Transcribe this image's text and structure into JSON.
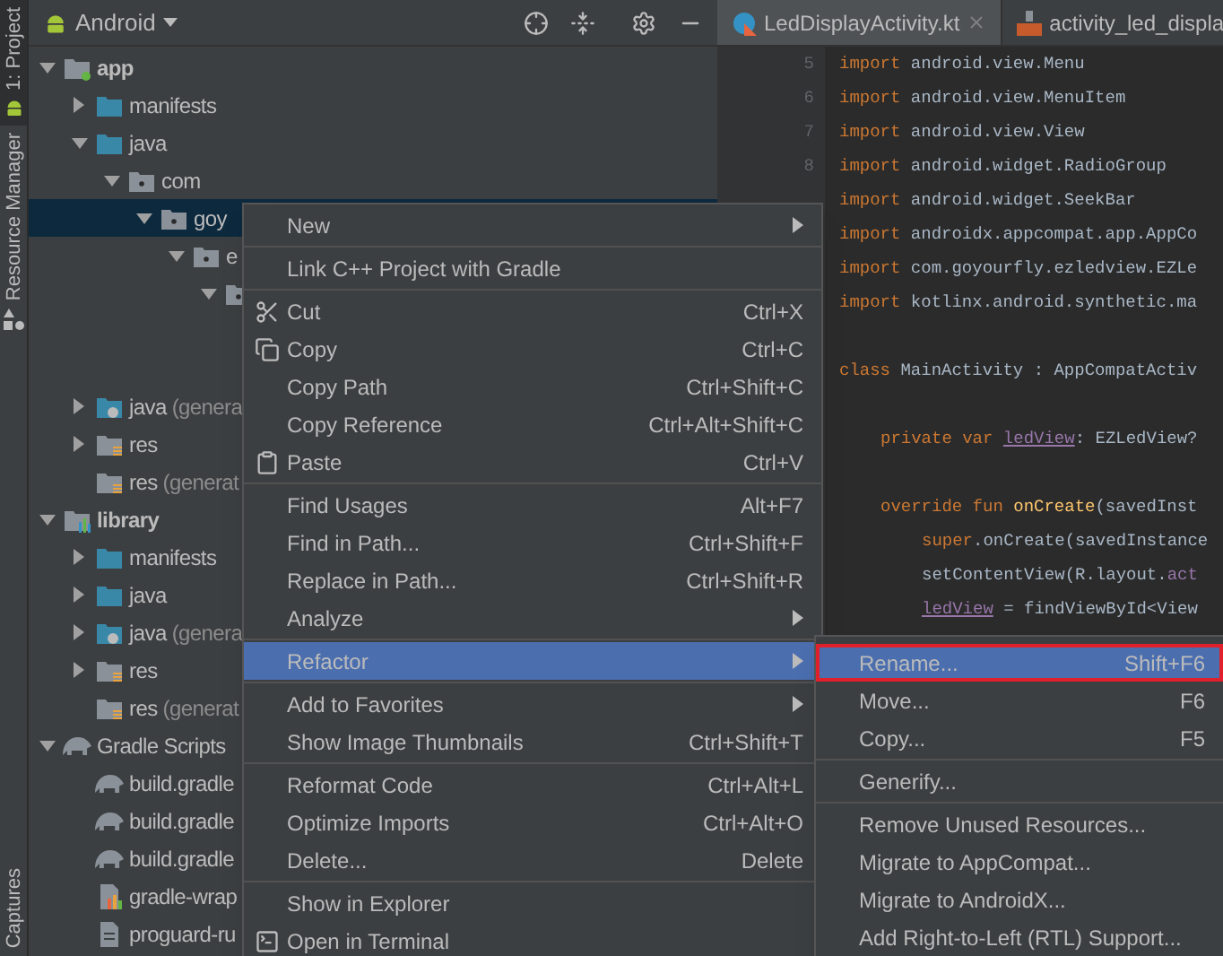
{
  "side_tabs": [
    {
      "label": "1: Project",
      "selected": true
    },
    {
      "label": "Resource Manager",
      "selected": false
    },
    {
      "label": "Captures",
      "selected": false
    }
  ],
  "project_panel": {
    "view": "Android",
    "tree": [
      {
        "label": "app",
        "kind": "module-app",
        "bold": true,
        "expanded": true,
        "selected": false,
        "children": [
          {
            "label": "manifests",
            "kind": "folder",
            "expanded": false,
            "selected": false
          },
          {
            "label": "java",
            "kind": "folder",
            "expanded": true,
            "selected": false,
            "children": [
              {
                "label": "com",
                "kind": "package",
                "expanded": true,
                "selected": false,
                "children": [
                  {
                    "label": "goy",
                    "kind": "package",
                    "expanded": true,
                    "selected": true,
                    "children": [
                      {
                        "label": "e",
                        "kind": "package",
                        "expanded": true,
                        "selected": false,
                        "children": [
                          {
                            "kind": "package",
                            "expanded": true,
                            "selected": false
                          }
                        ]
                      }
                    ]
                  }
                ]
              }
            ]
          },
          {
            "label": "java",
            "note": "(genera",
            "kind": "generated",
            "expanded": false,
            "selected": false
          },
          {
            "label": "res",
            "kind": "res",
            "expanded": false,
            "selected": false
          },
          {
            "label": "res",
            "note": "(generat",
            "kind": "res",
            "selected": false
          }
        ]
      },
      {
        "label": "library",
        "kind": "module-lib",
        "bold": true,
        "expanded": true,
        "selected": false,
        "children": [
          {
            "label": "manifests",
            "kind": "folder",
            "expanded": false,
            "selected": false
          },
          {
            "label": "java",
            "kind": "folder",
            "expanded": false,
            "selected": false
          },
          {
            "label": "java",
            "note": "(genera",
            "kind": "generated",
            "expanded": false,
            "selected": false
          },
          {
            "label": "res",
            "kind": "res",
            "expanded": false,
            "selected": false
          },
          {
            "label": "res",
            "note": "(generat",
            "kind": "res",
            "selected": false
          }
        ]
      },
      {
        "label": "Gradle Scripts",
        "kind": "gradle",
        "expanded": true,
        "selected": false,
        "children": [
          {
            "label": "build.gradle",
            "kind": "gradle",
            "selected": false
          },
          {
            "label": "build.gradle",
            "kind": "gradle",
            "selected": false
          },
          {
            "label": "build.gradle",
            "kind": "gradle",
            "selected": false
          },
          {
            "label": "gradle-wrap",
            "kind": "properties",
            "selected": false
          },
          {
            "label": "proguard-ru",
            "kind": "file",
            "selected": false
          }
        ]
      }
    ]
  },
  "editor": {
    "tabs": [
      {
        "label": "LedDisplayActivity.kt",
        "kind": "kotlin",
        "selected": true,
        "closable": true
      },
      {
        "label": "activity_led_displa",
        "kind": "layout",
        "selected": false,
        "closable": false
      }
    ],
    "lines": [
      {
        "number": "5",
        "kind": "top",
        "tokens": [
          {
            "t": "import ",
            "kind": "kw"
          },
          {
            "t": "android.view.Menu",
            "kind": "plain"
          }
        ]
      },
      {
        "number": "6",
        "kind": "top",
        "tokens": [
          {
            "t": "import ",
            "kind": "kw"
          },
          {
            "t": "android.view.MenuItem",
            "kind": "plain"
          }
        ]
      },
      {
        "number": "7",
        "kind": "top",
        "tokens": [
          {
            "t": "import ",
            "kind": "kw"
          },
          {
            "t": "android.view.View",
            "kind": "plain"
          }
        ]
      },
      {
        "number": "8",
        "kind": "top",
        "tokens": [
          {
            "t": "import ",
            "kind": "kw"
          },
          {
            "t": "android.widget.RadioGroup",
            "kind": "plain"
          }
        ]
      },
      {
        "kind": "top",
        "tokens": [
          {
            "t": "import ",
            "kind": "kw"
          },
          {
            "t": "android.widget.SeekBar",
            "kind": "plain"
          }
        ]
      },
      {
        "kind": "top",
        "tokens": [
          {
            "t": "import ",
            "kind": "kw"
          },
          {
            "t": "androidx.appcompat.app.AppCo",
            "kind": "plain"
          }
        ]
      },
      {
        "kind": "top",
        "tokens": [
          {
            "t": "import ",
            "kind": "kw"
          },
          {
            "t": "com.goyourfly.ezledview.EZLe",
            "kind": "plain"
          }
        ]
      },
      {
        "kind": "top",
        "tokens": [
          {
            "t": "import ",
            "kind": "kw"
          },
          {
            "t": "kotlinx.android.synthetic.ma",
            "kind": "plain"
          }
        ]
      },
      {
        "kind": "blank"
      },
      {
        "kind": "top",
        "tokens": [
          {
            "t": "class ",
            "kind": "kw"
          },
          {
            "t": "MainActivity : AppCompatActiv",
            "kind": "plain"
          }
        ]
      },
      {
        "kind": "blank"
      },
      {
        "kind": "member",
        "tokens": [
          {
            "t": "private var ",
            "kind": "kw"
          },
          {
            "t": "ledView",
            "kind": "field"
          },
          {
            "t": ": EZLedView?",
            "kind": "plain"
          }
        ]
      },
      {
        "kind": "blank"
      },
      {
        "kind": "member",
        "tokens": [
          {
            "t": "override fun ",
            "kind": "kw"
          },
          {
            "t": "onCreate",
            "kind": "fn"
          },
          {
            "t": "(savedInst",
            "kind": "plain"
          }
        ]
      },
      {
        "kind": "body",
        "tokens": [
          {
            "t": "super",
            "kind": "kw"
          },
          {
            "t": ".onCreate(savedInstance",
            "kind": "plain"
          }
        ]
      },
      {
        "kind": "body",
        "tokens": [
          {
            "t": "setContentView(R.layout.",
            "kind": "plain"
          },
          {
            "t": "act",
            "kind": "prop"
          }
        ]
      },
      {
        "kind": "body",
        "tokens": [
          {
            "t": "ledView",
            "kind": "field"
          },
          {
            "t": " = findViewById<View",
            "kind": "plain"
          }
        ]
      }
    ]
  },
  "context_menu": {
    "groups": [
      [
        {
          "label": "New",
          "submenu": true,
          "selected": false
        }
      ],
      [
        {
          "label": "Link C++ Project with Gradle",
          "selected": false
        }
      ],
      [
        {
          "label": "Cut",
          "kind": "scissors",
          "shortcut": "Ctrl+X",
          "selected": false
        },
        {
          "label": "Copy",
          "kind": "copy",
          "shortcut": "Ctrl+C",
          "selected": false
        },
        {
          "label": "Copy Path",
          "shortcut": "Ctrl+Shift+C",
          "selected": false
        },
        {
          "label": "Copy Reference",
          "shortcut": "Ctrl+Alt+Shift+C",
          "selected": false
        },
        {
          "label": "Paste",
          "kind": "clipboard",
          "shortcut": "Ctrl+V",
          "selected": false
        }
      ],
      [
        {
          "label": "Find Usages",
          "shortcut": "Alt+F7",
          "selected": false
        },
        {
          "label": "Find in Path...",
          "shortcut": "Ctrl+Shift+F",
          "selected": false
        },
        {
          "label": "Replace in Path...",
          "shortcut": "Ctrl+Shift+R",
          "selected": false
        },
        {
          "label": "Analyze",
          "submenu": true,
          "selected": false
        }
      ],
      [
        {
          "label": "Refactor",
          "submenu": true,
          "selected": true
        }
      ],
      [
        {
          "label": "Add to Favorites",
          "submenu": true,
          "selected": false
        },
        {
          "label": "Show Image Thumbnails",
          "shortcut": "Ctrl+Shift+T",
          "selected": false
        }
      ],
      [
        {
          "label": "Reformat Code",
          "shortcut": "Ctrl+Alt+L",
          "selected": false
        },
        {
          "label": "Optimize Imports",
          "shortcut": "Ctrl+Alt+O",
          "selected": false
        },
        {
          "label": "Delete...",
          "shortcut": "Delete",
          "selected": false
        }
      ],
      [
        {
          "label": "Show in Explorer",
          "selected": false
        },
        {
          "label": "Open in Terminal",
          "kind": "terminal",
          "selected": false
        }
      ]
    ]
  },
  "submenu": {
    "groups": [
      [
        {
          "label": "Rename...",
          "shortcut": "Shift+F6",
          "selected": true
        },
        {
          "label": "Move...",
          "shortcut": "F6",
          "selected": false
        },
        {
          "label": "Copy...",
          "shortcut": "F5",
          "selected": false
        }
      ],
      [
        {
          "label": "Generify...",
          "selected": false
        }
      ],
      [
        {
          "label": "Remove Unused Resources...",
          "selected": false
        },
        {
          "label": "Migrate to AppCompat...",
          "selected": false
        },
        {
          "label": "Migrate to AndroidX...",
          "selected": false
        },
        {
          "label": "Add Right-to-Left (RTL) Support...",
          "selected": false
        }
      ]
    ]
  }
}
